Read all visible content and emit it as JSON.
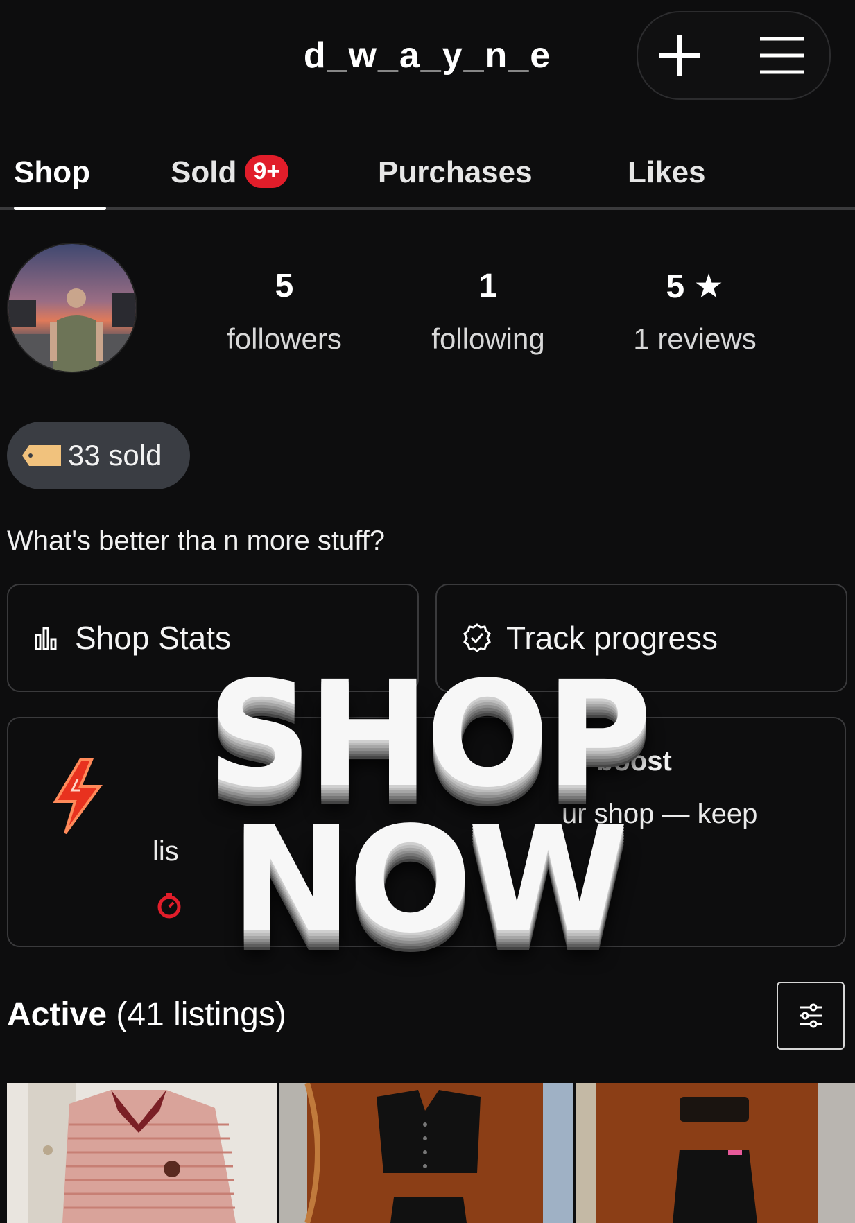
{
  "header": {
    "username": "d_w_a_y_n_e",
    "add_icon": "plus-icon",
    "menu_icon": "hamburger-menu-icon"
  },
  "tabs": [
    {
      "label": "Shop",
      "active": true
    },
    {
      "label": "Sold",
      "badge": "9+"
    },
    {
      "label": "Purchases"
    },
    {
      "label": "Likes"
    }
  ],
  "profile": {
    "followers_count": "5",
    "followers_label": "followers",
    "following_count": "1",
    "following_label": "following",
    "rating": "5",
    "reviews_label": "1 reviews",
    "sold_label": "33 sold",
    "bio": "What's better tha n more stuff?"
  },
  "actions": {
    "shop_stats": "Shop Stats",
    "track_progress": "Track progress"
  },
  "boost_card": {
    "title_fragment": "boost",
    "text_fragment": "ur shop — keep",
    "text_start": "lis"
  },
  "listings": {
    "title": "Active",
    "count_text": "(41 listings)"
  },
  "overlay": {
    "line1": "SHOP",
    "line2": "NOW"
  },
  "colors": {
    "background": "#0d0d0e",
    "badge": "#e11d2a",
    "pill": "#3a3d43",
    "border": "#3a3a3c"
  }
}
